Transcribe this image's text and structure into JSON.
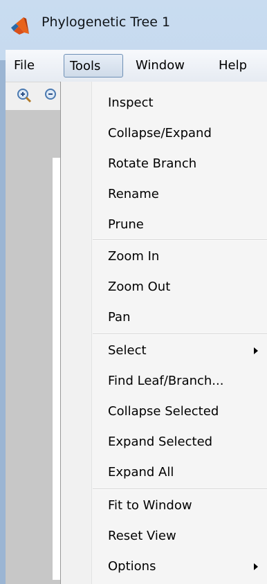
{
  "window": {
    "title": "Phylogenetic Tree 1",
    "icon": "matlab-icon"
  },
  "menubar": {
    "items": [
      {
        "label": "File"
      },
      {
        "label": "Tools"
      },
      {
        "label": "Window"
      },
      {
        "label": "Help"
      }
    ],
    "open_menu": "Tools"
  },
  "toolbar": {
    "icons": [
      "zoom-in-icon",
      "zoom-out-icon"
    ]
  },
  "tools_menu": {
    "items": [
      {
        "label": "Inspect"
      },
      {
        "label": "Collapse/Expand"
      },
      {
        "label": "Rotate Branch"
      },
      {
        "label": "Rename"
      },
      {
        "label": "Prune"
      },
      {
        "label": "Zoom In"
      },
      {
        "label": "Zoom Out"
      },
      {
        "label": "Pan"
      },
      {
        "label": "Select",
        "submenu": true
      },
      {
        "label": "Find Leaf/Branch..."
      },
      {
        "label": "Collapse Selected"
      },
      {
        "label": "Expand Selected"
      },
      {
        "label": "Expand All"
      },
      {
        "label": "Fit to Window"
      },
      {
        "label": "Reset View"
      },
      {
        "label": "Options",
        "submenu": true
      }
    ]
  },
  "colors": {
    "window_frame": "#b9d0ea",
    "menu_background": "#f5f5f5",
    "open_menu_border": "#6d8fb5"
  }
}
